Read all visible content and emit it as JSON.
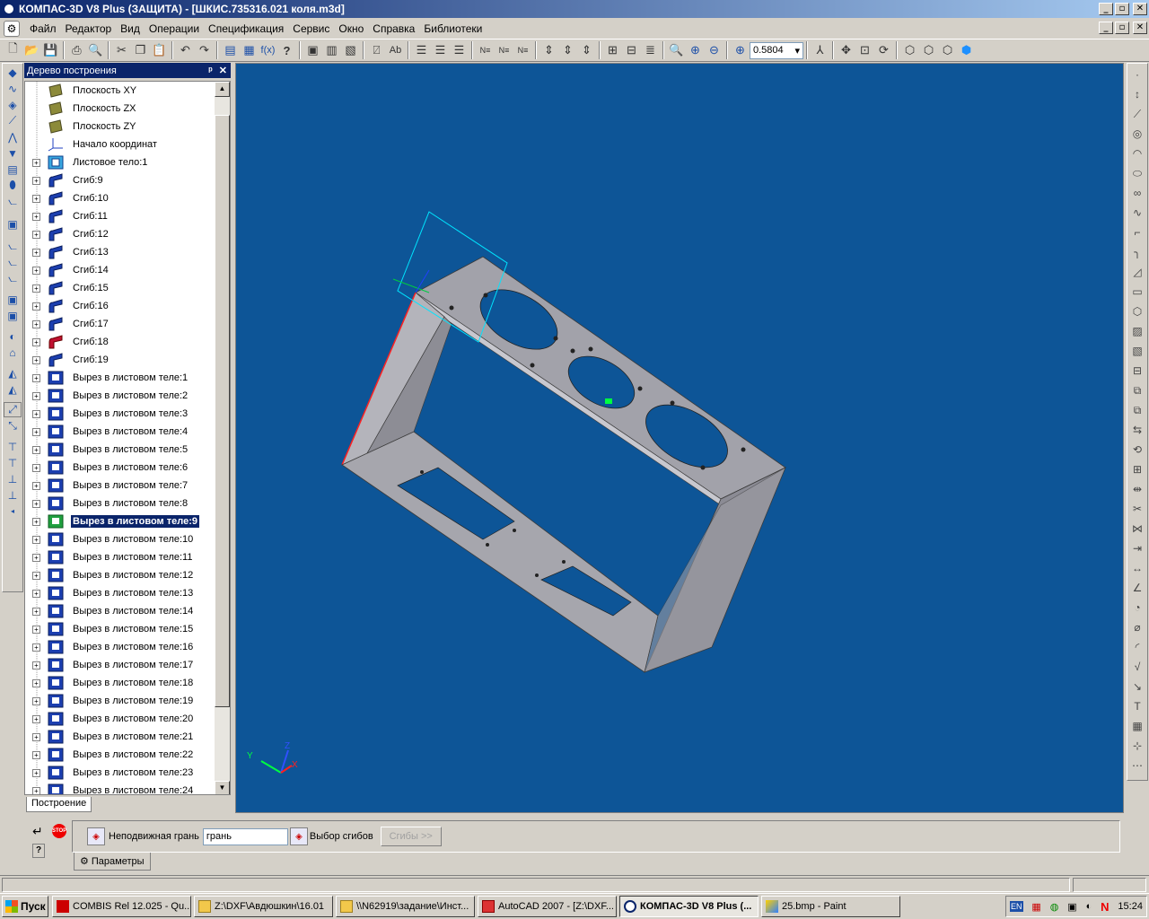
{
  "window": {
    "title": "КОМПАС-3D V8 Plus (ЗАЩИТА) - [ШКИС.735316.021 коля.m3d]",
    "min_label": "_",
    "restore_label": "▫",
    "close_label": "✕"
  },
  "menu": {
    "items": [
      "Файл",
      "Редактор",
      "Вид",
      "Операции",
      "Спецификация",
      "Сервис",
      "Окно",
      "Справка",
      "Библиотеки"
    ]
  },
  "toolbar": {
    "zoom_value": "0.5804"
  },
  "tree": {
    "title": "Дерево построения",
    "pin_label": "ᵖ",
    "close_label": "✕",
    "tab_label": "Построение",
    "items": [
      {
        "label": "Плоскость XY",
        "type": "plane",
        "expand": false
      },
      {
        "label": "Плоскость ZX",
        "type": "plane",
        "expand": false
      },
      {
        "label": "Плоскость ZY",
        "type": "plane",
        "expand": false
      },
      {
        "label": "Начало координат",
        "type": "origin",
        "expand": false
      },
      {
        "label": "Листовое тело:1",
        "type": "sheet",
        "expand": true
      },
      {
        "label": "Сгиб:9",
        "type": "bend",
        "expand": true
      },
      {
        "label": "Сгиб:10",
        "type": "bend",
        "expand": true
      },
      {
        "label": "Сгиб:11",
        "type": "bend",
        "expand": true
      },
      {
        "label": "Сгиб:12",
        "type": "bend",
        "expand": true
      },
      {
        "label": "Сгиб:13",
        "type": "bend",
        "expand": true
      },
      {
        "label": "Сгиб:14",
        "type": "bend",
        "expand": true
      },
      {
        "label": "Сгиб:15",
        "type": "bend",
        "expand": true
      },
      {
        "label": "Сгиб:16",
        "type": "bend",
        "expand": true
      },
      {
        "label": "Сгиб:17",
        "type": "bend",
        "expand": true
      },
      {
        "label": "Сгиб:18",
        "type": "bend-red",
        "expand": true
      },
      {
        "label": "Сгиб:19",
        "type": "bend",
        "expand": true
      },
      {
        "label": "Вырез в листовом теле:1",
        "type": "cut",
        "expand": true
      },
      {
        "label": "Вырез в листовом теле:2",
        "type": "cut",
        "expand": true
      },
      {
        "label": "Вырез в листовом теле:3",
        "type": "cut",
        "expand": true
      },
      {
        "label": "Вырез в листовом теле:4",
        "type": "cut",
        "expand": true
      },
      {
        "label": "Вырез в листовом теле:5",
        "type": "cut",
        "expand": true
      },
      {
        "label": "Вырез в листовом теле:6",
        "type": "cut",
        "expand": true
      },
      {
        "label": "Вырез в листовом теле:7",
        "type": "cut",
        "expand": true
      },
      {
        "label": "Вырез в листовом теле:8",
        "type": "cut",
        "expand": true
      },
      {
        "label": "Вырез в листовом теле:9",
        "type": "cut-green",
        "expand": true,
        "selected": true
      },
      {
        "label": "Вырез в листовом теле:10",
        "type": "cut",
        "expand": true
      },
      {
        "label": "Вырез в листовом теле:11",
        "type": "cut",
        "expand": true
      },
      {
        "label": "Вырез в листовом теле:12",
        "type": "cut",
        "expand": true
      },
      {
        "label": "Вырез в листовом теле:13",
        "type": "cut",
        "expand": true
      },
      {
        "label": "Вырез в листовом теле:14",
        "type": "cut",
        "expand": true
      },
      {
        "label": "Вырез в листовом теле:15",
        "type": "cut",
        "expand": true
      },
      {
        "label": "Вырез в листовом теле:16",
        "type": "cut",
        "expand": true
      },
      {
        "label": "Вырез в листовом теле:17",
        "type": "cut",
        "expand": true
      },
      {
        "label": "Вырез в листовом теле:18",
        "type": "cut",
        "expand": true
      },
      {
        "label": "Вырез в листовом теле:19",
        "type": "cut",
        "expand": true
      },
      {
        "label": "Вырез в листовом теле:20",
        "type": "cut",
        "expand": true
      },
      {
        "label": "Вырез в листовом теле:21",
        "type": "cut",
        "expand": true
      },
      {
        "label": "Вырез в листовом теле:22",
        "type": "cut",
        "expand": true
      },
      {
        "label": "Вырез в листовом теле:23",
        "type": "cut",
        "expand": true
      },
      {
        "label": "Вырез в листовом теле:24",
        "type": "cut",
        "expand": true
      }
    ]
  },
  "viewport": {
    "background": "#0d5597",
    "axis_x": "X",
    "axis_y": "Y",
    "axis_z": "Z"
  },
  "properties": {
    "fixed_face_label": "Неподвижная грань",
    "fixed_face_value": "грань",
    "bend_select_label": "Выбор сгибов",
    "bends_button": "Сгибы  >>",
    "tab_label": "Параметры",
    "stop_label": "STOP",
    "help_label": "?"
  },
  "taskbar": {
    "start": "Пуск",
    "tasks": [
      {
        "label": "COMBIS Rel 12.025 - Qu...",
        "icon": "combis-icon"
      },
      {
        "label": "Z:\\DXF\\Авдюшкин\\16.01",
        "icon": "folder-icon"
      },
      {
        "label": "\\\\N62919\\задание\\Инст...",
        "icon": "folder-icon"
      },
      {
        "label": "AutoCAD 2007 - [Z:\\DXF...",
        "icon": "autocad-icon"
      },
      {
        "label": "КОМПАС-3D V8 Plus (...",
        "icon": "kompas-icon",
        "active": true
      },
      {
        "label": "25.bmp - Paint",
        "icon": "paint-icon"
      }
    ],
    "lang": "EN",
    "clock": "15:24"
  },
  "colors": {
    "title_start": "#0a246a",
    "title_end": "#a6caf0",
    "part_face": "#a9a9b0",
    "selection_cyan": "#00e5ff",
    "edge_red": "#ff2020"
  }
}
